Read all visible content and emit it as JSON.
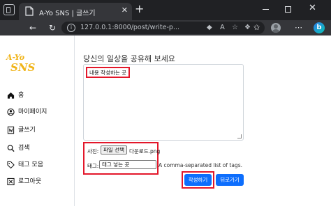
{
  "browser": {
    "tab_title": "A-Yo SNS | 글쓰기",
    "tab_close": "✕",
    "new_tab": "+",
    "url": "127.0.0.1:8000/post/write-p...",
    "nav": {
      "back": "←",
      "refresh": "↻"
    },
    "window": {
      "close": "✕"
    }
  },
  "logo": {
    "top": "A-Yo",
    "bottom": "SNS"
  },
  "sidebar": {
    "items": [
      {
        "icon": "home-icon",
        "label": "홈"
      },
      {
        "icon": "user-circle-icon",
        "label": "마이페이지"
      },
      {
        "icon": "write-icon",
        "label": "글쓰기"
      },
      {
        "icon": "search-icon",
        "label": "검색"
      },
      {
        "icon": "tag-icon",
        "label": "태그 모음"
      },
      {
        "icon": "logout-icon",
        "label": "로그아웃"
      }
    ]
  },
  "form": {
    "heading": "당신의 일상을 공유해 보세요",
    "content_text": "내용 작성하는 곳",
    "photo_label": "사진:",
    "file_button_label": "파일 선택",
    "file_name": "다운로드.png",
    "tag_label": "태그:",
    "tag_value": "태그 넣는 곳",
    "tag_help": "A comma-separated list of tags.",
    "submit_label": "작성하기",
    "back_label": "뒤로가기"
  },
  "colors": {
    "annotation_red": "#e3172a",
    "button_blue": "#0d6efd",
    "logo_yellow": "#f0b419",
    "chrome_dark": "#202124"
  }
}
